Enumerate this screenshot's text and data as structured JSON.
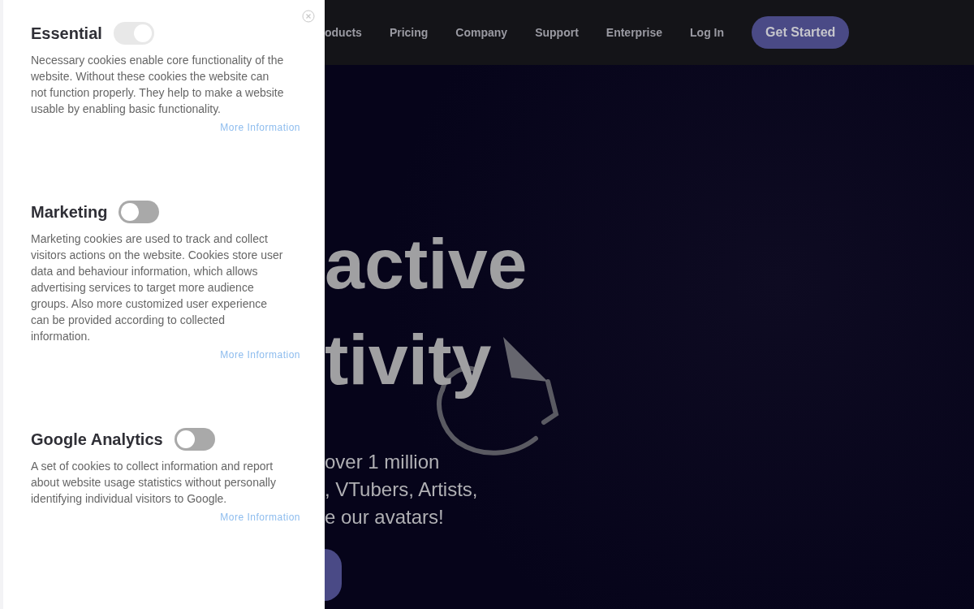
{
  "cookie_panel": {
    "sections": [
      {
        "title": "Essential",
        "toggle": {
          "on": true,
          "disabled": true
        },
        "description": "Necessary cookies enable core functionality of the website. Without these cookies the website can not function properly. They help to make a website usable by enabling basic functionality.",
        "link": "More Information"
      },
      {
        "title": "Marketing",
        "toggle": {
          "on": false,
          "disabled": false
        },
        "description": "Marketing cookies are used to track and collect visitors actions on the website. Cookies store user data and behaviour information, which allows advertising services to target more audience groups. Also more customized user experience can be provided according to collected information.",
        "link": "More Information"
      },
      {
        "title": "Google Analytics",
        "toggle": {
          "on": false,
          "disabled": false
        },
        "description": "A set of cookies to collect information and report about website usage statistics without personally identifying individual visitors to Google.",
        "link": "More Information"
      }
    ]
  },
  "nav": {
    "items": [
      "oducts",
      "Pricing",
      "Company",
      "Support",
      "Enterprise",
      "Log In"
    ],
    "cta": "Get Started"
  },
  "hero": {
    "heading_lines": [
      "active",
      "tivity"
    ],
    "subtitle_lines": [
      "over 1 million",
      ", VTubers, Artists,",
      "e our avatars!"
    ]
  }
}
